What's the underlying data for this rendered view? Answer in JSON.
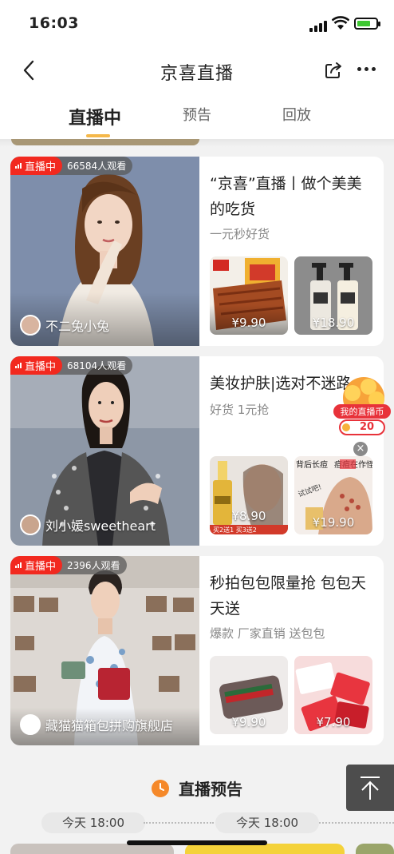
{
  "status_bar": {
    "time": "16:03"
  },
  "header": {
    "title": "京喜直播"
  },
  "tabs": [
    {
      "label": "直播中",
      "active": true
    },
    {
      "label": "预告",
      "active": false
    },
    {
      "label": "回放",
      "active": false
    }
  ],
  "live_badge": "直播中",
  "cards": [
    {
      "viewers": "66584人观看",
      "host": "不二兔小兔",
      "title": "“京喜”直播丨做个美美的吃货",
      "subtitle": "一元秒好货",
      "products": [
        {
          "price": "¥9.90"
        },
        {
          "price": "¥18.90"
        }
      ]
    },
    {
      "viewers": "68104人观看",
      "host": "刘小媛sweetheart",
      "title": "美妆护肤|选对不迷路",
      "subtitle": "好货 1元抢",
      "products": [
        {
          "price": "¥8.90"
        },
        {
          "price": "¥19.90"
        }
      ],
      "product_tags": [
        "买2送1 买3送2",
        "背后长痘",
        "痘痘在作怪",
        "试试吧!"
      ]
    },
    {
      "viewers": "2396人观看",
      "host": "藏猫猫箱包拼购旗舰店",
      "title": "秒拍包包限量抢 包包天天送",
      "subtitle": "爆款 厂家直销 送包包",
      "products": [
        {
          "price": "¥9.90"
        },
        {
          "price": "¥7.90"
        }
      ]
    }
  ],
  "coin_widget": {
    "label": "我的直播币",
    "count": "20"
  },
  "preview_section": {
    "title": "直播预告",
    "times": [
      "今天 18:00",
      "今天 18:00"
    ]
  },
  "colors": {
    "live_red": "#f2291f",
    "accent": "#f5b84a",
    "clock": "#f5892a"
  },
  "icons": [
    "back-icon",
    "share-icon",
    "more-icon",
    "clock-icon",
    "back-to-top-icon",
    "close-icon"
  ]
}
